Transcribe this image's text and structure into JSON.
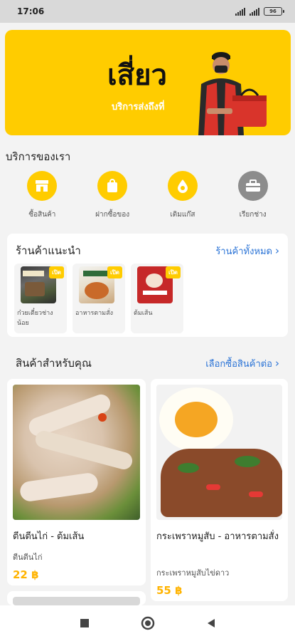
{
  "status_bar": {
    "time": "17:06",
    "battery": "96"
  },
  "banner": {
    "brand_name": "เสี่ยว",
    "tagline": "บริการส่งถึงที่"
  },
  "services": {
    "title": "บริการของเรา",
    "items": [
      {
        "label": "ซื้อสินค้า",
        "icon": "store-icon"
      },
      {
        "label": "ฝากซื้อของ",
        "icon": "shopping-bag-icon"
      },
      {
        "label": "เติมแก๊ส",
        "icon": "gas-drop-icon"
      },
      {
        "label": "เรียกช่าง",
        "icon": "toolbox-icon"
      }
    ]
  },
  "recommended": {
    "title": "ร้านค้าแนะนำ",
    "link": "ร้านค้าทั้งหมด",
    "shops": [
      {
        "name": "ก๋วยเตี๋ยวช่างน้อย",
        "badge": "เปิด"
      },
      {
        "name": "อาหารตามสั่ง",
        "badge": "เปิด"
      },
      {
        "name": "ต้มเส้น",
        "badge": "เปิด"
      }
    ]
  },
  "products": {
    "title": "สินค้าสำหรับคุณ",
    "link": "เลือกซื้อสินค้าต่อ",
    "items": [
      {
        "name": "ตีนตีนไก่ - ต้มเส้น",
        "shop": "ตีนตีนไก่",
        "price": "22 ฿"
      },
      {
        "name": "กระเพราหมูสับ - อาหารตามสั่ง",
        "shop": "กระเพราหมูสับไข่ดาว",
        "price": "55 ฿"
      }
    ]
  },
  "colors": {
    "accent": "#ffcc00",
    "link": "#2a73d6",
    "price": "#ffb300"
  }
}
